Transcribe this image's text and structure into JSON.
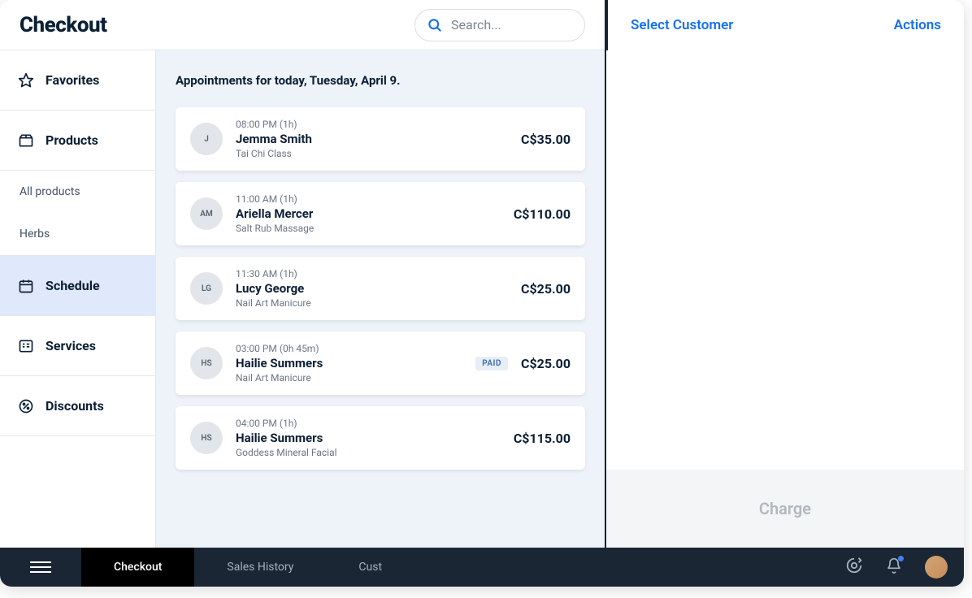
{
  "header": {
    "title": "Checkout",
    "search_placeholder": "Search..."
  },
  "sidebar": {
    "items": [
      {
        "label": "Favorites",
        "icon": "star"
      },
      {
        "label": "Products",
        "icon": "box",
        "expanded": true
      },
      {
        "label": "Schedule",
        "icon": "calendar",
        "active": true
      },
      {
        "label": "Services",
        "icon": "list"
      },
      {
        "label": "Discounts",
        "icon": "percent"
      }
    ],
    "sub_items": [
      {
        "label": "All products"
      },
      {
        "label": "Herbs"
      }
    ]
  },
  "main": {
    "title": "Appointments for today, Tuesday, April 9.",
    "appointments": [
      {
        "initials": "J",
        "time": "08:00 PM (1h)",
        "name": "Jemma Smith",
        "service": "Tai Chi Class",
        "price": "C$35.00",
        "paid": false
      },
      {
        "initials": "AM",
        "time": "11:00 AM (1h)",
        "name": "Ariella Mercer",
        "service": "Salt Rub Massage",
        "price": "C$110.00",
        "paid": false
      },
      {
        "initials": "LG",
        "time": "11:30 AM (1h)",
        "name": "Lucy George",
        "service": "Nail Art Manicure",
        "price": "C$25.00",
        "paid": false
      },
      {
        "initials": "HS",
        "time": "03:00 PM (0h 45m)",
        "name": "Hailie Summers",
        "service": "Nail Art Manicure",
        "price": "C$25.00",
        "paid": true
      },
      {
        "initials": "HS",
        "time": "04:00 PM (1h)",
        "name": "Hailie Summers",
        "service": "Goddess Mineral Facial",
        "price": "C$115.00",
        "paid": false
      }
    ]
  },
  "right_panel": {
    "select_customer": "Select Customer",
    "actions": "Actions",
    "charge_label": "Charge"
  },
  "bottom_bar": {
    "tabs": [
      {
        "label": "Checkout",
        "active": true
      },
      {
        "label": "Sales History"
      },
      {
        "label": "Cust"
      }
    ]
  },
  "badges": {
    "paid": "PAID"
  }
}
